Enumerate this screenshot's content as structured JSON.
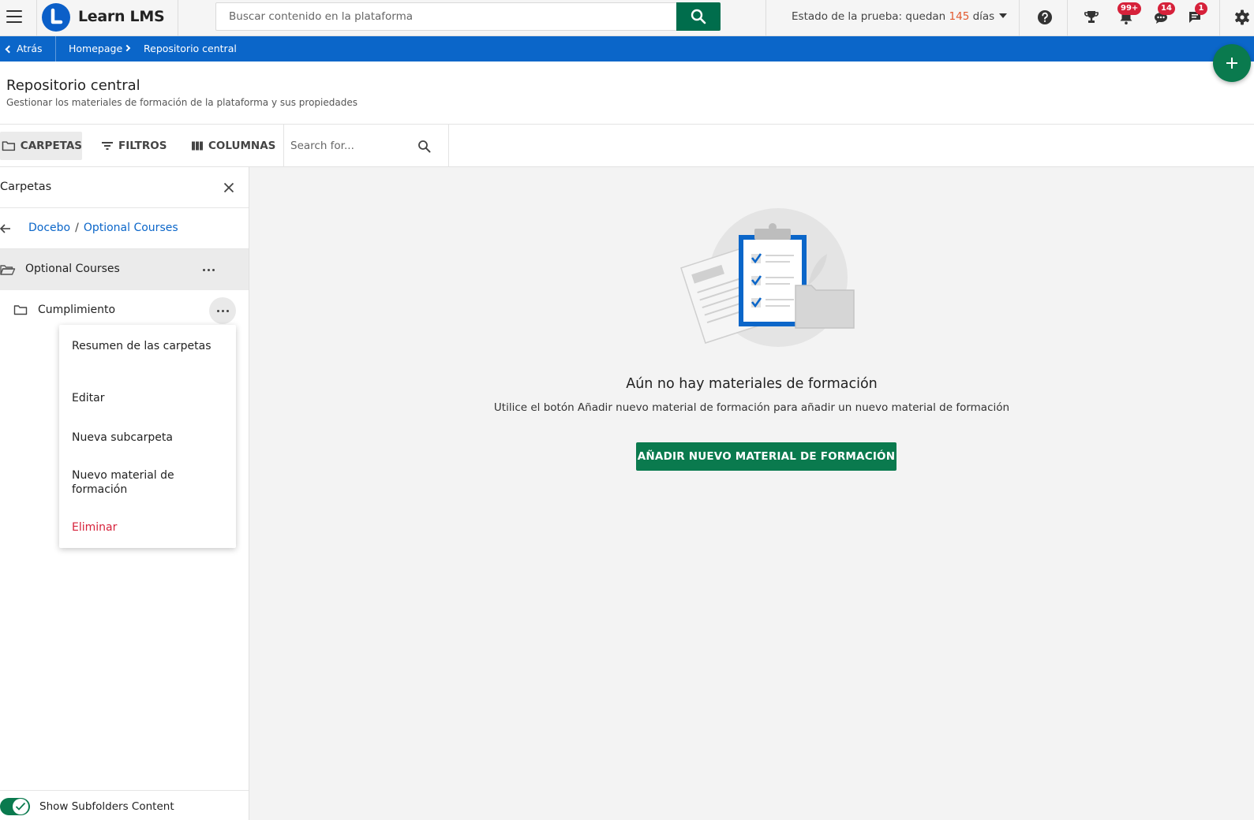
{
  "header": {
    "brand": "Learn LMS",
    "search_placeholder": "Buscar contenido en la plataforma",
    "trial_prefix": "Estado de la prueba: quedan ",
    "trial_days": "145",
    "trial_suffix": " días",
    "icons": [
      "menu-icon",
      "help-icon",
      "trophy-icon",
      "bell-icon",
      "chat-icon",
      "messages-icon",
      "gear-icon"
    ],
    "badges": {
      "notifications": "99+",
      "chat": "14",
      "messages": "1"
    },
    "accent": "#006d4c",
    "trial_days_color": "#e2592f"
  },
  "breadcrumb": {
    "back": "Atrás",
    "items": [
      "Homepage",
      "Repositorio central"
    ],
    "bar_color": "#0b66c9"
  },
  "page": {
    "title": "Repositorio central",
    "subtitle": "Gestionar los materiales de formación de la plataforma y sus propiedades"
  },
  "toolbar": {
    "folders": "CARPETAS",
    "filters": "FILTROS",
    "columns": "COLUMNAS",
    "search_placeholder": "Search for..."
  },
  "folders_panel": {
    "title": "Carpetas",
    "path": [
      "Docebo",
      "Optional Courses"
    ],
    "current_folder": "Optional Courses",
    "subfolders": [
      "Cumplimiento"
    ],
    "context_menu": [
      "Resumen de las carpetas",
      "Editar",
      "Nueva subcarpeta",
      "Nuevo material de formación",
      "Eliminar"
    ],
    "show_subfolders_label": "Show Subfolders Content",
    "show_subfolders_on": true
  },
  "empty_state": {
    "title": "Aún no hay materiales de formación",
    "text": "Utilice el botón Añadir nuevo material de formación para añadir un nuevo material de formación",
    "button": "AÑADIR NUEVO MATERIAL DE FORMACIÓN"
  }
}
